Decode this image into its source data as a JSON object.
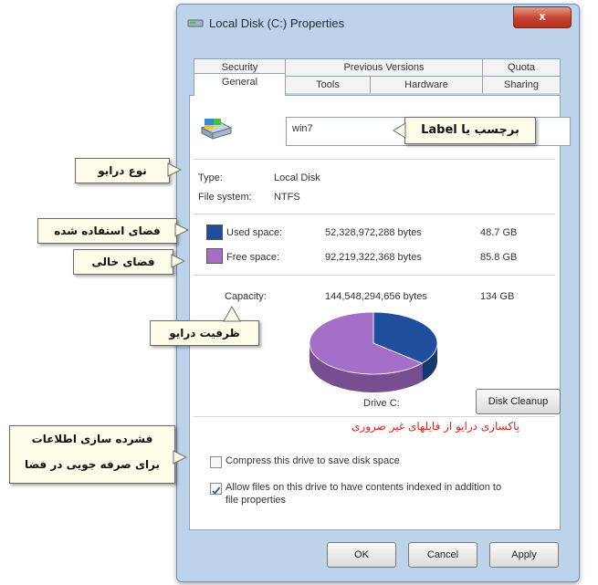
{
  "window": {
    "title": "Local Disk (C:) Properties",
    "close_glyph": "x"
  },
  "tabs_row1": [
    "Security",
    "Previous Versions",
    "Quota"
  ],
  "tabs_row2": [
    "General",
    "Tools",
    "Hardware",
    "Sharing"
  ],
  "general": {
    "volume_label": "win7",
    "type_label": "Type:",
    "type_value": "Local Disk",
    "fs_label": "File system:",
    "fs_value": "NTFS",
    "used_label": "Used space:",
    "used_bytes": "52,328,972,288 bytes",
    "used_gb": "48.7 GB",
    "free_label": "Free space:",
    "free_bytes": "92,219,322,368 bytes",
    "free_gb": "85.8 GB",
    "capacity_label": "Capacity:",
    "capacity_bytes": "144,548,294,656 bytes",
    "capacity_gb": "134 GB",
    "drive_label": "Drive C:",
    "cleanup_button": "Disk Cleanup",
    "compress_label": "Compress this drive to save disk space",
    "index_label_1": "Allow files on this drive to have contents indexed in addition to",
    "index_label_2": "file properties",
    "compress_checked": false,
    "index_checked": true
  },
  "buttons": {
    "ok": "OK",
    "cancel": "Cancel",
    "apply": "Apply"
  },
  "chart_data": {
    "type": "pie",
    "categories": [
      "Used space",
      "Free space"
    ],
    "values": [
      48.7,
      85.8
    ],
    "colors": [
      "#1f4e9c",
      "#a56ec9"
    ]
  },
  "annotations": {
    "label_callout": "برچسب یا Label",
    "drive_type": "نوع درایو",
    "used_space": "فضای استفاده شده",
    "free_space": "فضای خالی",
    "capacity": "ظرفیت درایو",
    "cleanup_note": "پاکسازی درایو از فایلهای غیر ضروری",
    "compress_note_1": "فشرده سازی اطلاعات",
    "compress_note_2": "برای صرفه جویی در فضا"
  },
  "colors": {
    "used": "#1f4e9c",
    "free": "#a56ec9",
    "note_red": "#d9261c"
  }
}
